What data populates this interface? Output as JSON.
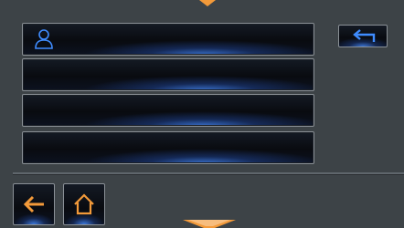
{
  "colors": {
    "background": "#3d4347",
    "button_border": "#8a9096",
    "button_glow": "#4a8cff",
    "icon_blue": "#3f8cff",
    "icon_orange": "#f39a3a"
  },
  "icons": {
    "scroll_up": "triangle-down-orange",
    "contact": "person-outline-icon",
    "return": "return-arrow-icon",
    "back": "arrow-left-icon",
    "home": "home-icon",
    "scroll_down": "triangle-down-orange"
  },
  "list": {
    "items": [
      {
        "label": "",
        "icon": "person-icon"
      },
      {
        "label": ""
      },
      {
        "label": ""
      },
      {
        "label": ""
      }
    ]
  }
}
